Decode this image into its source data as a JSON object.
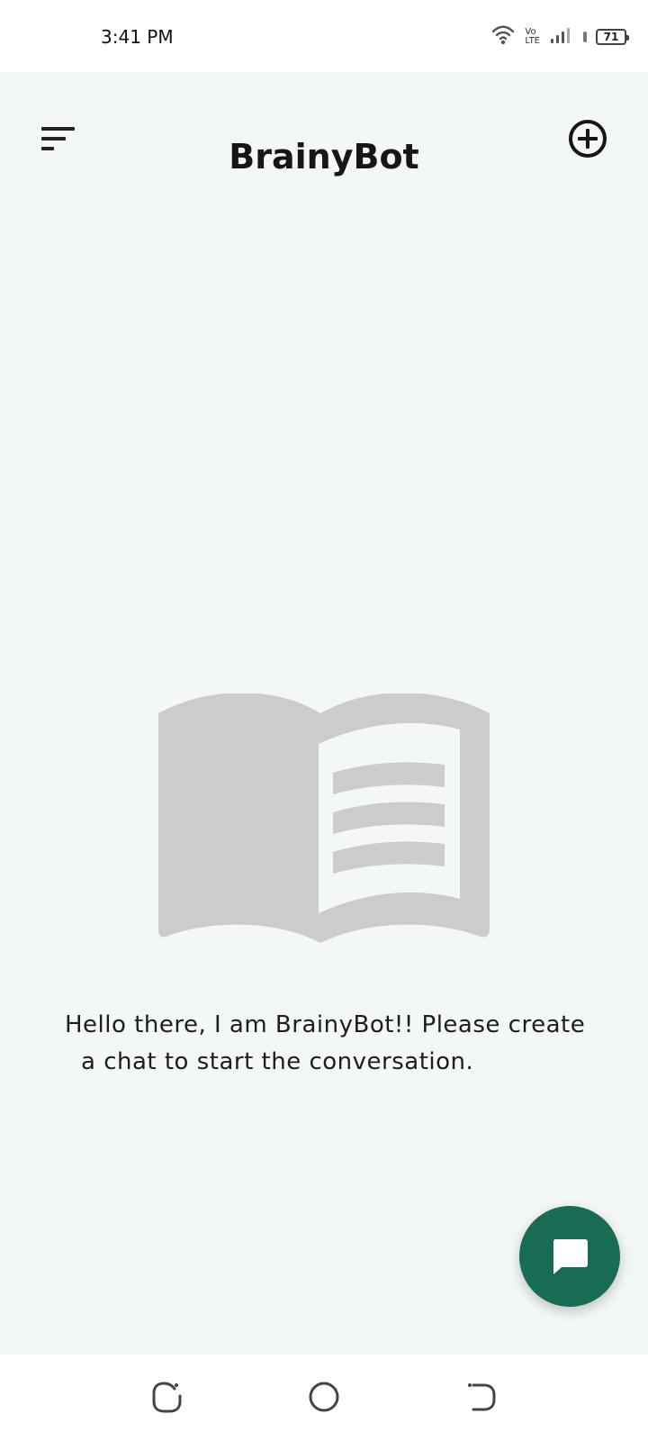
{
  "status_bar": {
    "time": "3:41 PM",
    "network_label_top": "Vo",
    "network_label_bottom": "LTE",
    "battery_level": "71"
  },
  "app_bar": {
    "title": "BrainyBot",
    "menu_icon": "filter-list-icon",
    "new_chat_icon": "add-circle-icon"
  },
  "empty_state": {
    "illustration_icon": "open-book-icon",
    "message_line_1": "Hello there, I am BrainyBot!! Please create",
    "message_line_2": "a chat to start the conversation."
  },
  "fab": {
    "icon": "chat-bubble-icon"
  },
  "navigation_bar": {
    "recents_icon": "recents-icon",
    "home_icon": "home-circle-icon",
    "back_icon": "back-icon"
  },
  "colors": {
    "app_background": "#f3f8f5",
    "fab_background": "#186b55",
    "illustration": "#cccccc",
    "text": "#1d1d1d"
  }
}
